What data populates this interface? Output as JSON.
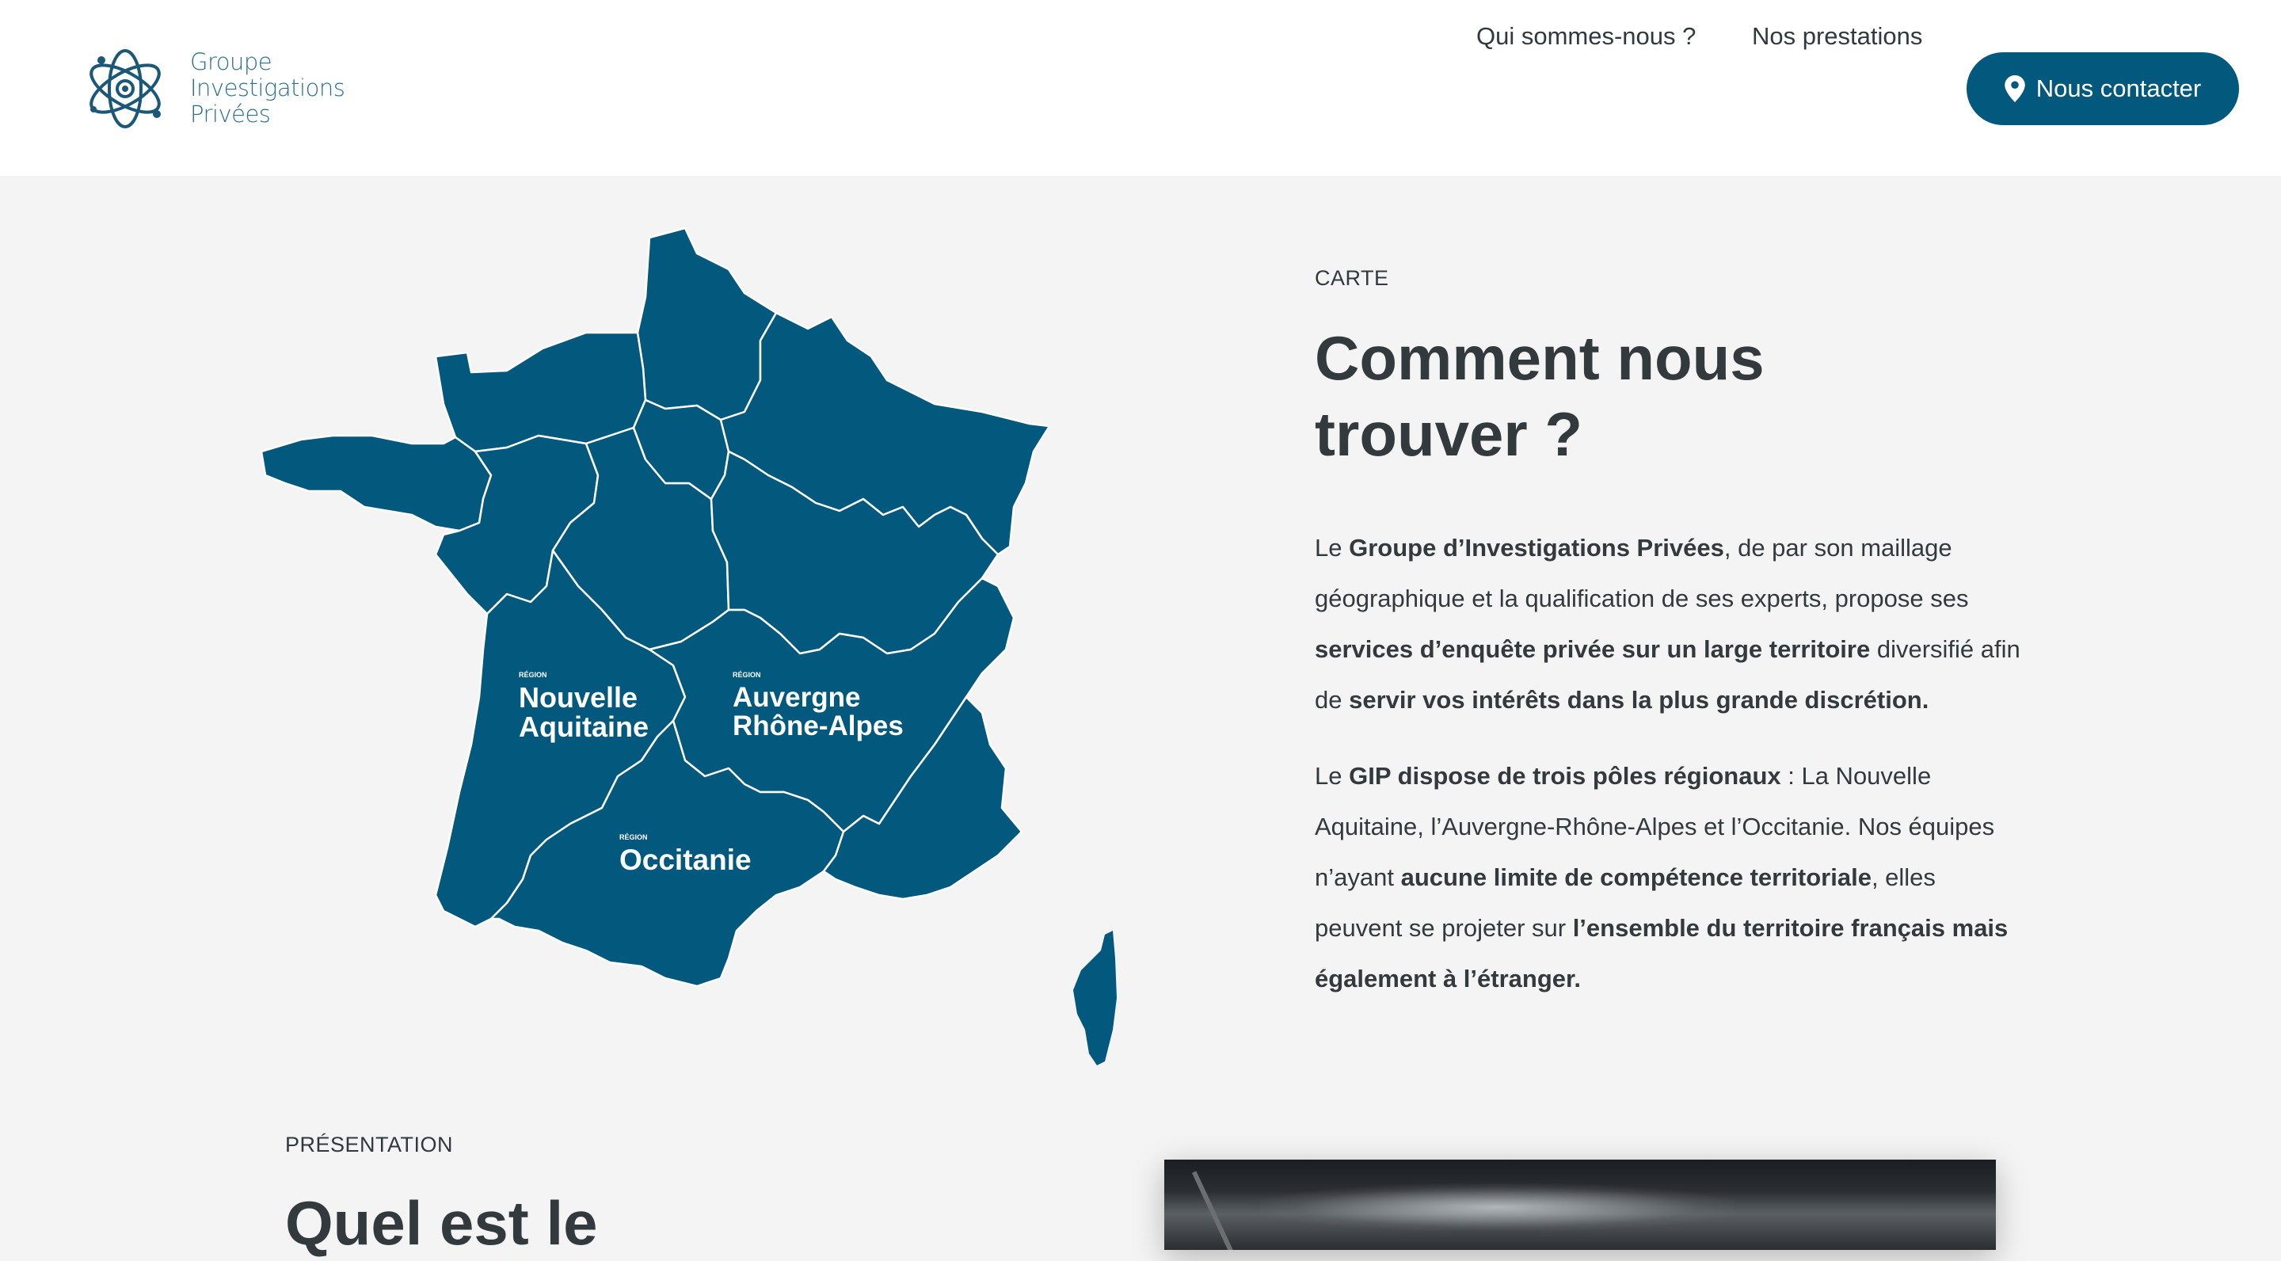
{
  "header": {
    "logo": {
      "line1": "Groupe",
      "line2": "Investigations",
      "line3": "Privées"
    },
    "nav": {
      "about": "Qui sommes-nous ?",
      "services": "Nos prestations",
      "contact": "Nous contacter"
    }
  },
  "map": {
    "fill_color": "#03587d",
    "regions": [
      {
        "eyebrow": "RÉGION",
        "line1": "Nouvelle",
        "line2": "Aquitaine"
      },
      {
        "eyebrow": "RÉGION",
        "line1": "Auvergne",
        "line2": "Rhône-Alpes"
      },
      {
        "eyebrow": "RÉGION",
        "line1": "Occitanie",
        "line2": ""
      }
    ]
  },
  "carte": {
    "eyebrow": "CARTE",
    "heading_line1": "Comment nous",
    "heading_line2": "trouver ?",
    "p1": {
      "t1": "Le ",
      "b1": "Groupe d’Investigations Privées",
      "t2": ", de par son maillage géographique et la qualification de ses experts, propose ses ",
      "b2": "services d’enquête privée sur un large territoire",
      "t3": " diversifié afin de ",
      "b3": "servir vos intérêts dans la plus grande discrétion."
    },
    "p2": {
      "t1": "Le ",
      "b1": "GIP dispose de trois pôles régionaux",
      "t2": " : La Nouvelle Aquitaine, l’Auvergne-Rhône-Alpes et l’Occitanie. Nos équipes n’ayant ",
      "b2": "aucune limite de compétence territoriale",
      "t3": ", elles peuvent se projeter sur ",
      "b3": "l’ensemble du territoire français mais également à l’étranger."
    }
  },
  "presentation": {
    "eyebrow": "PRÉSENTATION",
    "heading": "Quel est le"
  },
  "colors": {
    "brand": "#03587d",
    "background": "#f4f4f4",
    "text": "#333a3d"
  }
}
